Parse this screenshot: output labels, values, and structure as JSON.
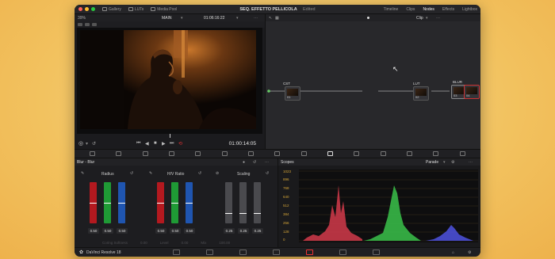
{
  "window": {
    "title": "SEQ. EFFETTO PELLICOLA",
    "status": "Edited",
    "left_items": [
      "Gallery",
      "LUTs",
      "Media Pool"
    ],
    "right_items": [
      "Timeline",
      "Clips",
      "Nodes",
      "Effects",
      "Lightbox"
    ],
    "active_right_item": "Nodes"
  },
  "viewer": {
    "zoom": "39%",
    "timeline_name": "MAIN",
    "source_timecode": "01:06:16:22",
    "timecode": "01:00:14:05"
  },
  "node_editor": {
    "mode": "Clip",
    "nodes": [
      {
        "label": "CST",
        "number": "01"
      },
      {
        "label": "LUT",
        "number": "02"
      },
      {
        "label": "BLUR",
        "number": "03"
      },
      {
        "label": "",
        "number": "04"
      }
    ]
  },
  "blur_panel": {
    "title": "Blur - Blur",
    "groups": [
      {
        "label": "Radius",
        "values": [
          "0.50",
          "0.50",
          "0.50"
        ]
      },
      {
        "label": "H/V Ratio",
        "values": [
          "0.50",
          "0.50",
          "0.50"
        ]
      },
      {
        "label": "Scaling",
        "values": [
          "0.25",
          "0.25",
          "0.25"
        ]
      }
    ],
    "faded_labels": [
      "Coring Softness",
      "0.00",
      "Level",
      "0.00",
      "Mix",
      "100.00"
    ]
  },
  "scopes": {
    "title": "Scopes",
    "mode": "Parade",
    "y_labels": [
      "1023",
      "896",
      "768",
      "640",
      "512",
      "384",
      "256",
      "128",
      "0"
    ]
  },
  "statusbar": {
    "app_name": "DaVinci Resolve 18"
  },
  "colors": {
    "accent_red": "#d92c2c",
    "accent_green": "#2fa84a",
    "accent_blue": "#2a64c8",
    "scope_label": "#d4a437"
  }
}
